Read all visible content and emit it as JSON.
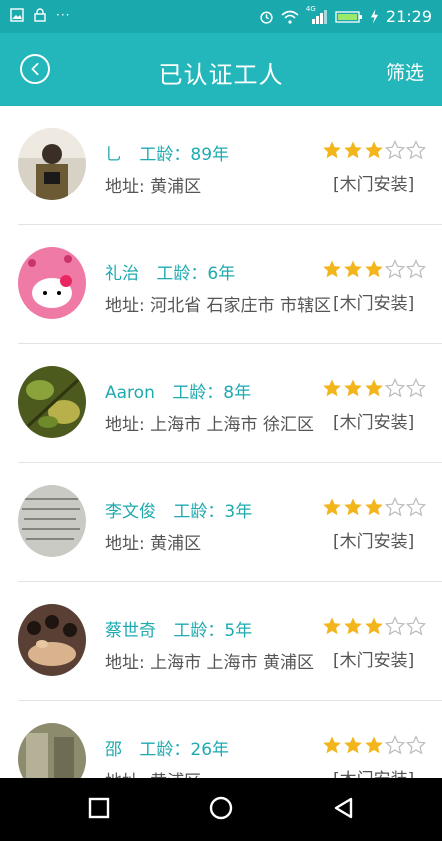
{
  "status_bar": {
    "time": "21:29",
    "icons": [
      "gallery-icon",
      "lock-icon",
      "more-dots-icon",
      "alarm-icon",
      "wifi-icon",
      "signal-icon",
      "battery-icon",
      "charging-icon"
    ],
    "network_label": "4G",
    "dots": "···"
  },
  "header": {
    "title": "已认证工人",
    "filter_label": "筛选",
    "back_icon": "chevron-left-icon"
  },
  "colors": {
    "status_bar": "#1aa9ad",
    "header": "#23b7bc",
    "accent_text": "#1faab0",
    "star_filled": "#f2b51c",
    "star_empty": "#bbbbbb"
  },
  "workers": [
    {
      "name": "乚",
      "age_label": "工龄：",
      "age_value": "89年",
      "address": "地址: 黄浦区",
      "rating": 3,
      "max_rating": 5,
      "category": "[木门安装]"
    },
    {
      "name": "礼治",
      "age_label": "工龄：",
      "age_value": "6年",
      "address": "地址: 河北省 石家庄市 市辖区",
      "rating": 3,
      "max_rating": 5,
      "category": "[木门安装]"
    },
    {
      "name": "Aaron",
      "age_label": "工龄：",
      "age_value": "8年",
      "address": "地址: 上海市 上海市 徐汇区",
      "rating": 3,
      "max_rating": 5,
      "category": "[木门安装]"
    },
    {
      "name": "李文俊",
      "age_label": "工龄：",
      "age_value": "3年",
      "address": "地址: 黄浦区",
      "rating": 3,
      "max_rating": 5,
      "category": "[木门安装]"
    },
    {
      "name": "蔡世奇",
      "age_label": "工龄：",
      "age_value": "5年",
      "address": "地址: 上海市 上海市 黄浦区",
      "rating": 3,
      "max_rating": 5,
      "category": "[木门安装]"
    },
    {
      "name": "邵",
      "age_label": "工龄：",
      "age_value": "26年",
      "address": "地址: 黄浦区",
      "rating": 3,
      "max_rating": 5,
      "category": "[木门安装]"
    }
  ],
  "nav_bar": {
    "items": [
      "recents-square-icon",
      "home-circle-icon",
      "back-triangle-icon"
    ]
  }
}
